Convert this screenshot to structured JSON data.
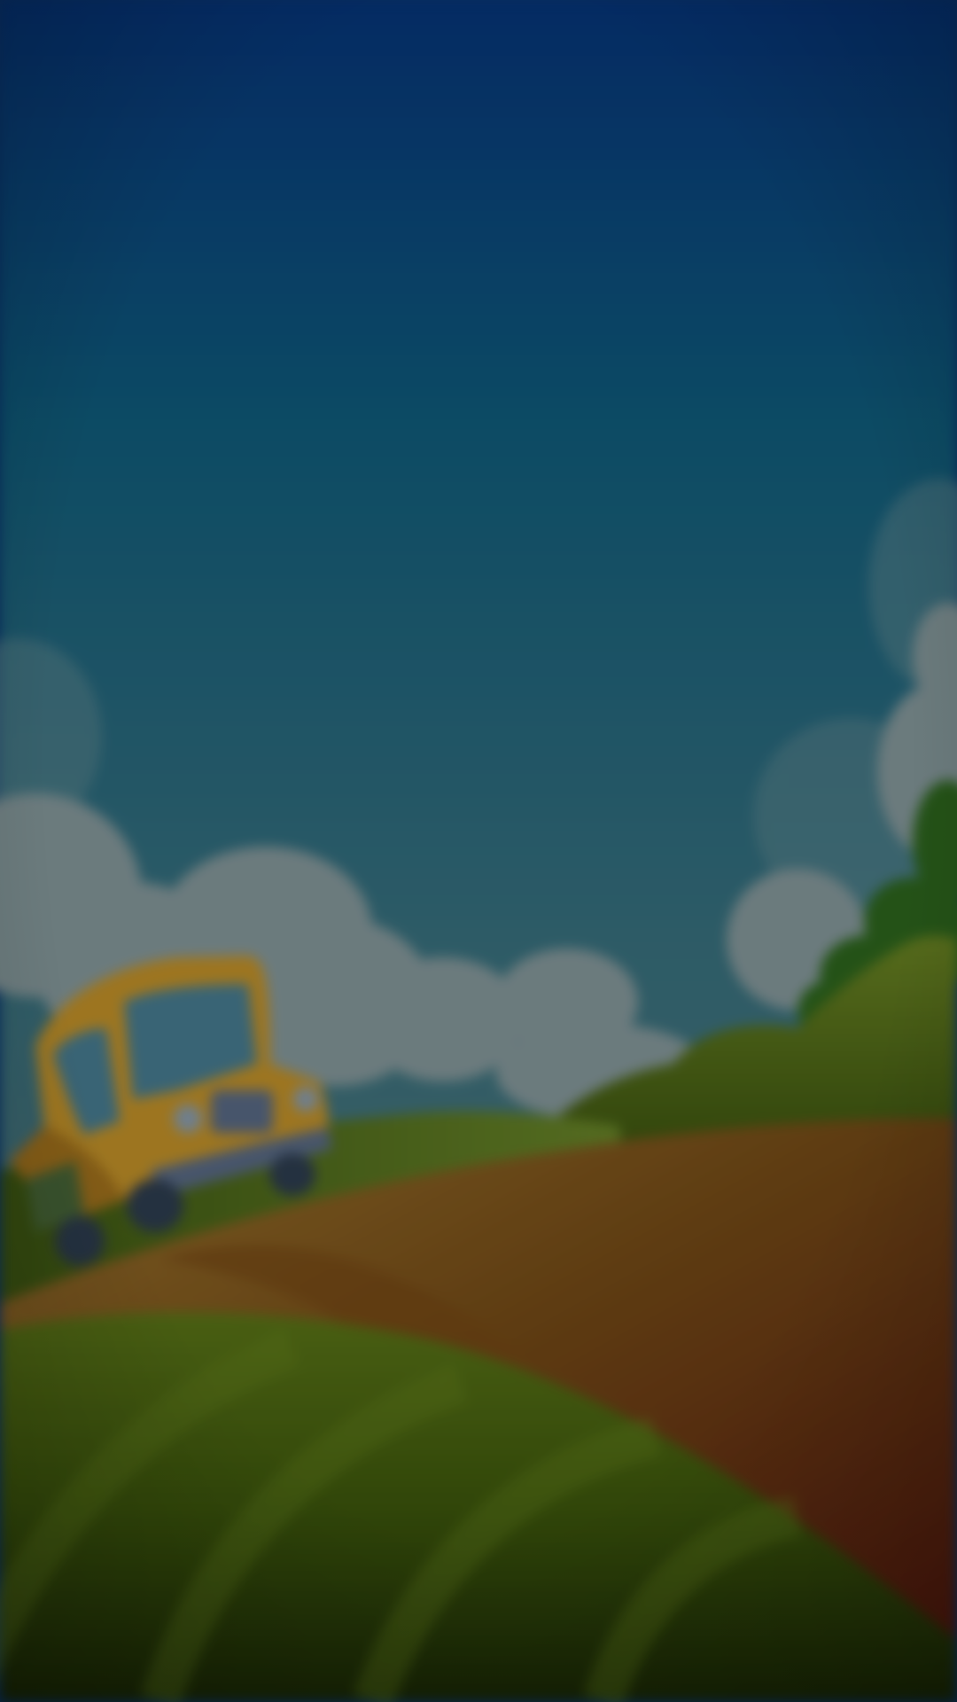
{
  "screen": {
    "type": "game-loading-background",
    "theme": "cartoon countryside with yellow bus",
    "state": "dimmed-blurred"
  },
  "colors": {
    "sky_top": "#06377f",
    "sky_mid": "#176b86",
    "sky_bottom": "#5c7f82",
    "cloud": "#8a9fa3",
    "cloud_shade": "#6f8a90",
    "hill_orange": "#8a5d22",
    "hill_orange_dark": "#5e1d10",
    "hill_green": "#566f12",
    "hill_green_dark": "#1e2e06",
    "bush_green": "#5f7a1c",
    "tree_green": "#2f6a1e",
    "bus_yellow": "#c9972a",
    "bus_window": "#4a8196",
    "bus_bumper": "#5c6e8a",
    "tire": "#2f3f52",
    "dim_overlay": "rgba(0,0,0,0.32)"
  },
  "icons": {
    "vehicle": "school-bus-icon"
  }
}
